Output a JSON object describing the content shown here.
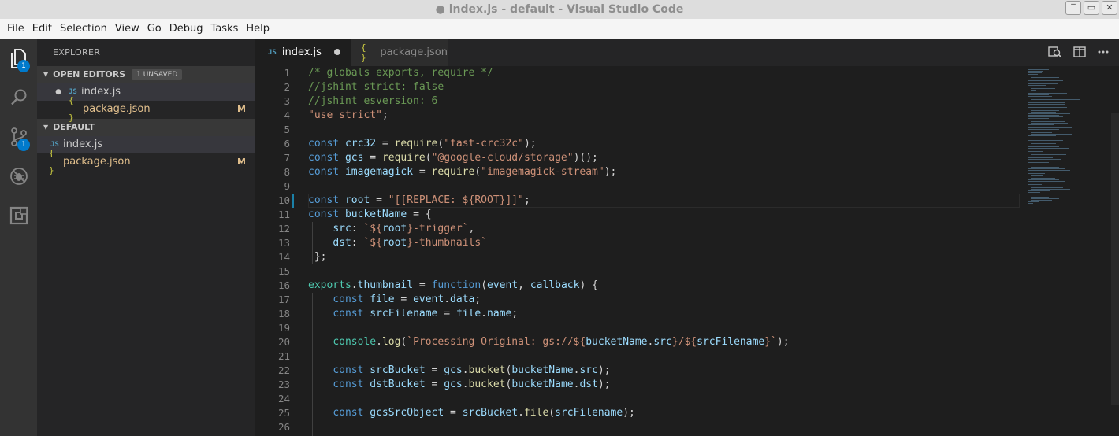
{
  "window": {
    "title": "● index.js - default - Visual Studio Code",
    "controls": [
      "‾",
      "▭",
      "✕"
    ]
  },
  "menu": [
    "File",
    "Edit",
    "Selection",
    "View",
    "Go",
    "Debug",
    "Tasks",
    "Help"
  ],
  "activity": {
    "explorer_badge": "1",
    "scm_badge": "1"
  },
  "sidebar": {
    "title": "EXPLORER",
    "open_editors": {
      "header": "OPEN EDITORS",
      "badge": "1 UNSAVED",
      "items": [
        {
          "icon": "JS",
          "label": "index.js",
          "dirty_dot": "●",
          "modified": ""
        },
        {
          "icon": "{ }",
          "label": "package.json",
          "dirty_dot": "",
          "modified": "M"
        }
      ]
    },
    "folder": {
      "header": "DEFAULT",
      "items": [
        {
          "icon": "JS",
          "label": "index.js",
          "modified": ""
        },
        {
          "icon": "{ }",
          "label": "package.json",
          "modified": "M"
        }
      ]
    }
  },
  "tabs": [
    {
      "icon": "JS",
      "label": "index.js"
    },
    {
      "icon": "{ }",
      "label": "package.json"
    }
  ],
  "editor": {
    "line_numbers": [
      "1",
      "2",
      "3",
      "4",
      "5",
      "6",
      "7",
      "8",
      "9",
      "10",
      "11",
      "12",
      "13",
      "14",
      "15",
      "16",
      "17",
      "18",
      "19",
      "20",
      "21",
      "22",
      "23",
      "24",
      "25",
      "26"
    ]
  },
  "colors": {
    "accent": "#007acc",
    "modified": "#e2c08d",
    "js_icon": "#519aba",
    "json_icon": "#cbcb41"
  }
}
